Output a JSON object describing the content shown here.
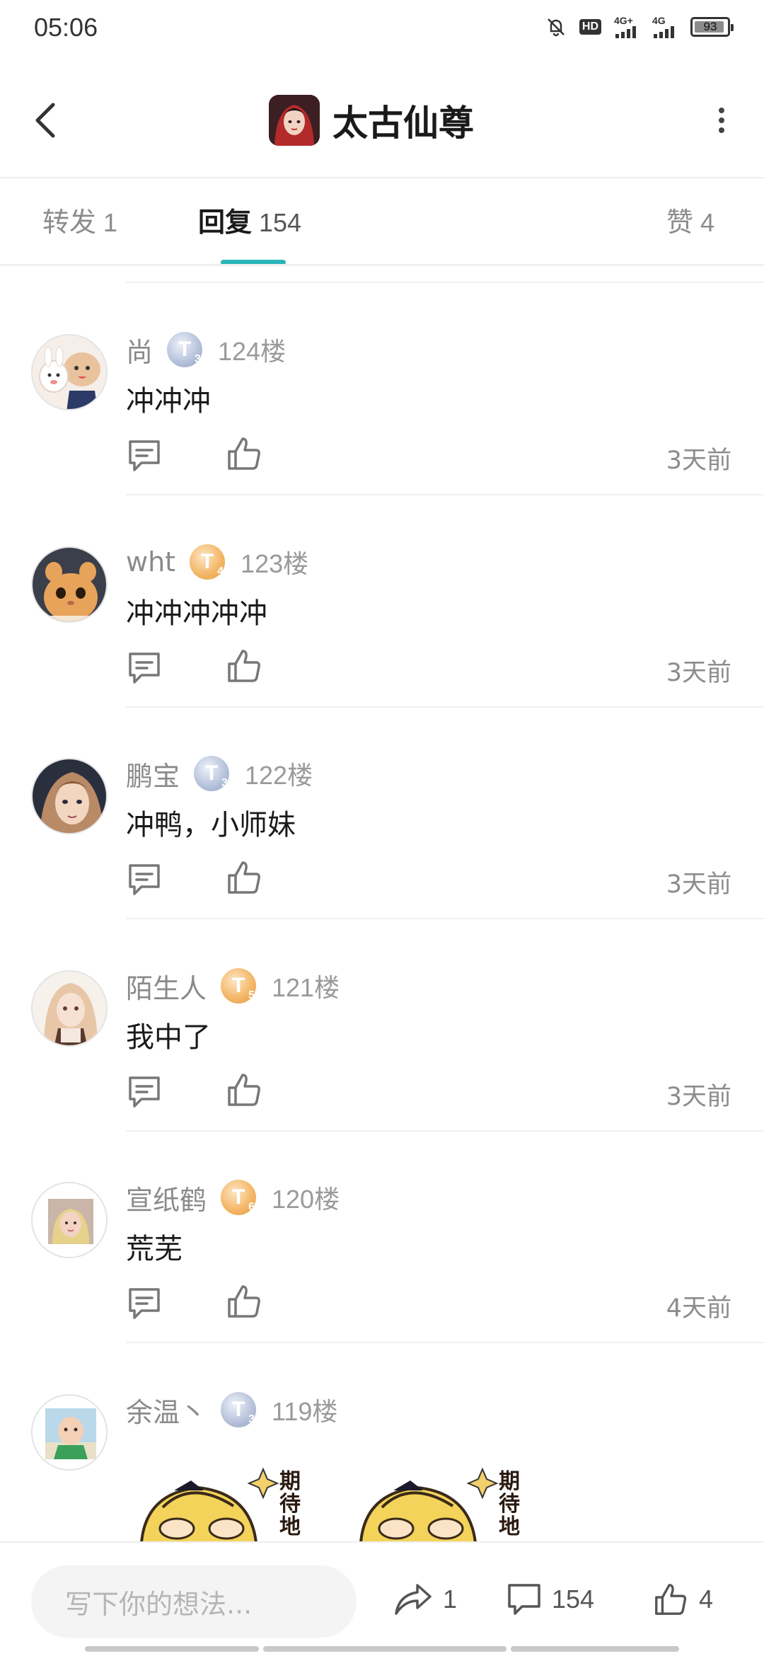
{
  "status_bar": {
    "time": "05:06",
    "battery": "93",
    "battery_fraction": 0.93,
    "network_label_1": "4G+",
    "network_label_2": "4G",
    "hd_label": "HD"
  },
  "header": {
    "title": "太古仙尊"
  },
  "tabs": [
    {
      "label": "转发",
      "count": "1",
      "active": false
    },
    {
      "label": "回复",
      "count": "154",
      "active": true
    },
    {
      "label": "赞",
      "count": "4",
      "active": false
    }
  ],
  "comments": [
    {
      "name": "尚",
      "badge_letter": "T",
      "badge_level": "3",
      "badge_type": "silver",
      "floor": "124楼",
      "text": "冲冲冲",
      "time": "3天前",
      "avatar": "cartoon-pig-avatar"
    },
    {
      "name": "wht",
      "badge_letter": "T",
      "badge_level": "4",
      "badge_type": "gold",
      "floor": "123楼",
      "text": "冲冲冲冲冲",
      "time": "3天前",
      "avatar": "cat-avatar"
    },
    {
      "name": "鹏宝",
      "badge_letter": "T",
      "badge_level": "3",
      "badge_type": "silver",
      "floor": "122楼",
      "text": "冲鸭，小师妹",
      "time": "3天前",
      "avatar": "anime-boy-avatar"
    },
    {
      "name": "陌生人",
      "badge_letter": "T",
      "badge_level": "5",
      "badge_type": "gold",
      "floor": "121楼",
      "text": "我中了",
      "time": "3天前",
      "avatar": "anime-girl-avatar"
    },
    {
      "name": "宣纸鹤",
      "badge_letter": "T",
      "badge_level": "6",
      "badge_type": "gold",
      "floor": "120楼",
      "text": "荒芜",
      "time": "4天前",
      "avatar": "photo-girl-avatar"
    },
    {
      "name": "余温丶",
      "badge_letter": "T",
      "badge_level": "3",
      "badge_type": "silver",
      "floor": "119楼",
      "text": "",
      "time": "",
      "avatar": "baby-avatar"
    }
  ],
  "stickers": {
    "caption": "期待地"
  },
  "bottom_bar": {
    "input_placeholder": "写下你的想法...",
    "share_count": "1",
    "comment_count": "154",
    "like_count": "4"
  },
  "colors": {
    "accent": "#2bb5b8",
    "text_primary": "#1a1a1a",
    "text_secondary": "#8c8c8c",
    "badge_silver": "#a9b6d2",
    "badge_gold": "#f0ad5c"
  }
}
